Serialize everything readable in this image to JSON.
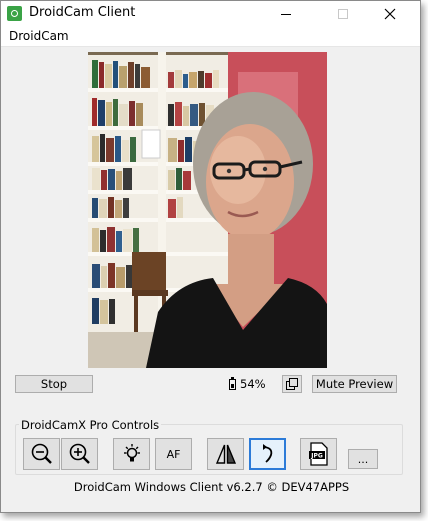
{
  "window": {
    "title": "DroidCam Client"
  },
  "menu": {
    "items": [
      "DroidCam"
    ]
  },
  "preview": {
    "icon": "camera-feed-preview"
  },
  "controls": {
    "stop_label": "Stop",
    "battery_text": "54%",
    "battery_level": 0.54,
    "mute_label": "Mute Preview"
  },
  "pro": {
    "group_label": "DroidCamX Pro Controls",
    "af_label": "AF",
    "more_label": "..."
  },
  "footer": {
    "text": "DroidCam Windows Client v6.2.7 © DEV47APPS"
  },
  "colors": {
    "accent": "#2c7bd8",
    "app_icon": "#3aa346",
    "wall": "#c25462"
  }
}
